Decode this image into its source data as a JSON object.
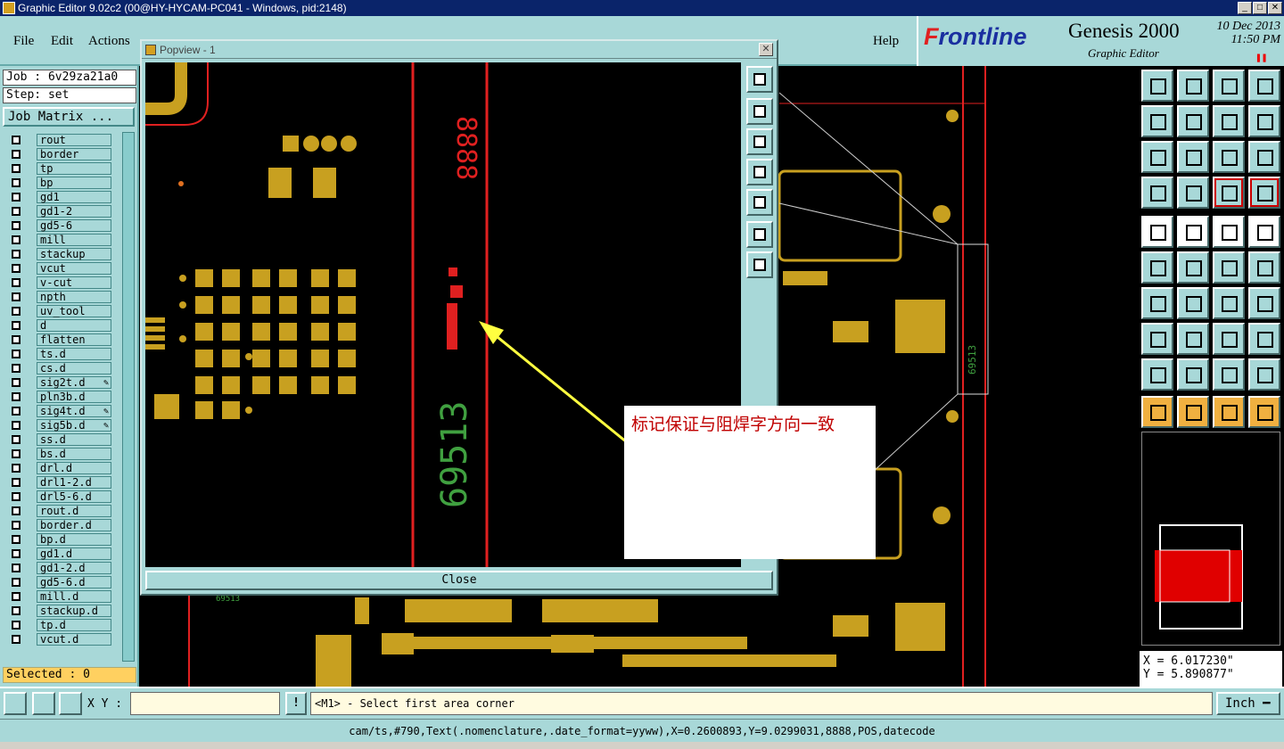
{
  "window": {
    "title": "Graphic Editor 9.02c2 (00@HY-HYCAM-PC041 - Windows, pid:2148)"
  },
  "menu": {
    "file": "File",
    "edit": "Edit",
    "actions": "Actions",
    "help": "Help"
  },
  "brand": {
    "logo_prefix": "F",
    "logo_rest": "rontline",
    "product": "Genesis 2000",
    "subtitle": "Graphic Editor",
    "date": "10 Dec 2013",
    "time": "11:50 PM"
  },
  "job": {
    "job_label": "Job : 6v29za21a0",
    "step_label": "Step: set",
    "matrix_button": "Job Matrix ...",
    "selected": "Selected : 0"
  },
  "layers": [
    {
      "name": "rout",
      "mark": ""
    },
    {
      "name": "border",
      "mark": ""
    },
    {
      "name": "tp",
      "mark": ""
    },
    {
      "name": "bp",
      "mark": ""
    },
    {
      "name": "gd1",
      "mark": ""
    },
    {
      "name": "gd1-2",
      "mark": ""
    },
    {
      "name": "gd5-6",
      "mark": ""
    },
    {
      "name": "mill",
      "mark": ""
    },
    {
      "name": "stackup",
      "mark": ""
    },
    {
      "name": "vcut",
      "mark": ""
    },
    {
      "name": "v-cut",
      "mark": ""
    },
    {
      "name": "npth",
      "mark": ""
    },
    {
      "name": "uv_tool",
      "mark": ""
    },
    {
      "name": "d",
      "mark": ""
    },
    {
      "name": "flatten",
      "mark": ""
    },
    {
      "name": "ts.d",
      "mark": ""
    },
    {
      "name": "cs.d",
      "mark": ""
    },
    {
      "name": "sig2t.d",
      "mark": "✎"
    },
    {
      "name": "pln3b.d",
      "mark": ""
    },
    {
      "name": "sig4t.d",
      "mark": "✎"
    },
    {
      "name": "sig5b.d",
      "mark": "✎"
    },
    {
      "name": "ss.d",
      "mark": ""
    },
    {
      "name": "bs.d",
      "mark": ""
    },
    {
      "name": "drl.d",
      "mark": ""
    },
    {
      "name": "drl1-2.d",
      "mark": ""
    },
    {
      "name": "drl5-6.d",
      "mark": ""
    },
    {
      "name": "rout.d",
      "mark": ""
    },
    {
      "name": "border.d",
      "mark": ""
    },
    {
      "name": "bp.d",
      "mark": ""
    },
    {
      "name": "gd1.d",
      "mark": ""
    },
    {
      "name": "gd1-2.d",
      "mark": ""
    },
    {
      "name": "gd5-6.d",
      "mark": ""
    },
    {
      "name": "mill.d",
      "mark": ""
    },
    {
      "name": "stackup.d",
      "mark": ""
    },
    {
      "name": "tp.d",
      "mark": ""
    },
    {
      "name": "vcut.d",
      "mark": ""
    }
  ],
  "popview": {
    "title": "Popview - 1",
    "close_x": "✕",
    "close_button": "Close",
    "silk_8888": "8888",
    "silk_69513": "69513",
    "small_69513": "69513"
  },
  "annotation": {
    "text": "标记保证与阻焊字方向一致"
  },
  "coords": {
    "x": "X = 6.017230\"",
    "y": "Y = 5.890877\""
  },
  "bottom": {
    "xy_label": "X Y :",
    "xy_value": "",
    "bang": "!",
    "prompt": "<M1> - Select first area corner",
    "unit": "Inch ━"
  },
  "status": {
    "text": "cam/ts,#790,Text(.nomenclature,.date_format=yyww),X=0.2600893,Y=9.0299031,8888,POS,datecode"
  },
  "colors": {
    "panel": "#a8d8d8",
    "pad": "#c8a020",
    "trace_red": "#e02020",
    "silk_green": "#40a040",
    "annotation_red": "#c00000",
    "arrow_yellow": "#ffff40"
  }
}
